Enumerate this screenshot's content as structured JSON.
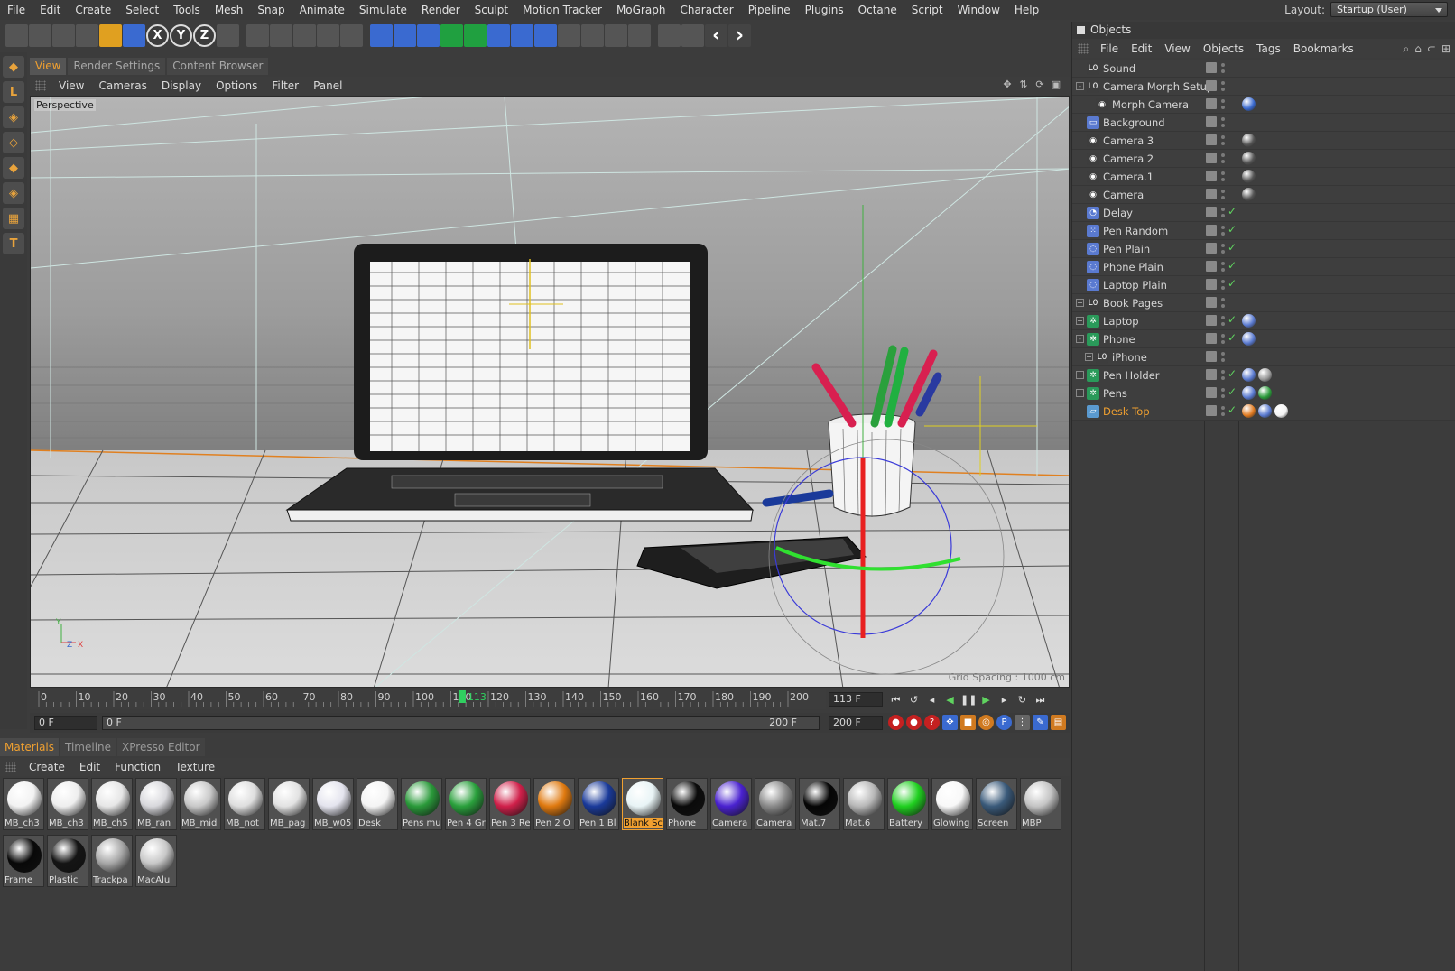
{
  "menubar": {
    "items": [
      "File",
      "Edit",
      "Create",
      "Select",
      "Tools",
      "Mesh",
      "Snap",
      "Animate",
      "Simulate",
      "Render",
      "Sculpt",
      "Motion Tracker",
      "MoGraph",
      "Character",
      "Pipeline",
      "Plugins",
      "Octane",
      "Script",
      "Window",
      "Help"
    ],
    "layout_label": "Layout:",
    "layout_value": "Startup (User)"
  },
  "toolbar": {
    "icons": [
      "select-arrow-icon",
      "live-select-icon",
      "rotate-select-icon",
      "move-icon",
      "scale-icon",
      "rotate-icon",
      "x-axis-icon",
      "y-axis-icon",
      "z-axis-icon",
      "coordinate-system-icon",
      "render-view-icon",
      "render-picture-icon",
      "edit-render-settings-icon",
      "render-queue-icon",
      "interactive-render-icon",
      "null-object-icon",
      "cube-icon",
      "sphere-icon",
      "nurbs-icon",
      "array-icon",
      "deformer-icon",
      "floor-icon",
      "scene-icon",
      "camera-icon",
      "light-icon",
      "help-icon",
      "calculator-icon",
      "octane-live-viewer-icon",
      "octane-settings-icon",
      "undo-arrow-icon",
      "redo-arrow-icon"
    ],
    "axis_labels": [
      "X",
      "Y",
      "Z"
    ]
  },
  "left_tools": [
    "model-mode-icon",
    "edge-mode-icon",
    "texture-mode-icon",
    "points-mode-icon",
    "polygon-mode-icon",
    "object-axis-icon",
    "checker-icon",
    "text-tool-icon"
  ],
  "viewport": {
    "tabs": [
      "View",
      "Render Settings",
      "Content Browser"
    ],
    "active_tab": "View",
    "menu": [
      "View",
      "Cameras",
      "Display",
      "Options",
      "Filter",
      "Panel"
    ],
    "camera_label": "Perspective",
    "grid_spacing": "Grid Spacing : 1000 cm",
    "axis_labels": [
      "Y",
      "Z",
      "X"
    ]
  },
  "timeline": {
    "ticks": [
      "0",
      "10",
      "20",
      "30",
      "40",
      "50",
      "60",
      "70",
      "80",
      "90",
      "100",
      "110",
      "120",
      "130",
      "140",
      "150",
      "160",
      "170",
      "180",
      "190",
      "200"
    ],
    "current_frame_marker": "113",
    "current_frame": "113 F",
    "start_field": "0 F",
    "range_start": "0 F",
    "range_end": "200 F",
    "end_field": "200 F"
  },
  "materials": {
    "tabs": [
      "Materials",
      "Timeline",
      "XPresso Editor"
    ],
    "active_tab": "Materials",
    "menu": [
      "Create",
      "Edit",
      "Function",
      "Texture"
    ],
    "items": [
      {
        "name": "MB_ch3",
        "color": "#f2f2f2"
      },
      {
        "name": "MB_ch3",
        "color": "#eeeeee"
      },
      {
        "name": "MB_ch5",
        "color": "#e6e6e6"
      },
      {
        "name": "MB_ran",
        "color": "#d8d8dc"
      },
      {
        "name": "MB_mid",
        "color": "#c8c8c8"
      },
      {
        "name": "MB_not",
        "color": "#dedede"
      },
      {
        "name": "MB_pag",
        "color": "#e2e2e2"
      },
      {
        "name": "MB_w05",
        "color": "#e4e4ee"
      },
      {
        "name": "Desk",
        "color": "#f4f4f4"
      },
      {
        "name": "Pens mu",
        "color": "#2a9a3a"
      },
      {
        "name": "Pen 4 Gr",
        "color": "#2aa03c"
      },
      {
        "name": "Pen 3 Re",
        "color": "#d0204a"
      },
      {
        "name": "Pen 2 O",
        "color": "#e07a10"
      },
      {
        "name": "Pen 1 Bl",
        "color": "#1a3a9a"
      },
      {
        "name": "Blank Sc",
        "color": "#e8f4f6"
      },
      {
        "name": "Phone",
        "color": "#0a0a0a"
      },
      {
        "name": "Camera",
        "color": "#4a22d0"
      },
      {
        "name": "Camera",
        "color": "#8a8a8a"
      },
      {
        "name": "Mat.7",
        "color": "#050505"
      },
      {
        "name": "Mat.6",
        "color": "#b8b8b8"
      },
      {
        "name": "Battery",
        "color": "#20d020"
      },
      {
        "name": "Glowing",
        "color": "#f8f8f8"
      },
      {
        "name": "Screen",
        "color": "#3a5a7a"
      },
      {
        "name": "MBP",
        "color": "#c4c4c4"
      },
      {
        "name": "Frame",
        "color": "#080808"
      },
      {
        "name": "Plastic",
        "color": "#141414"
      },
      {
        "name": "Trackpa",
        "color": "#a8a8a8"
      },
      {
        "name": "MacAlu",
        "color": "#c8c8c8"
      }
    ],
    "selected": "Blank Sc"
  },
  "objects": {
    "title": "Objects",
    "menu": [
      "File",
      "Edit",
      "View",
      "Objects",
      "Tags",
      "Bookmarks"
    ],
    "rows": [
      {
        "name": "Sound",
        "icon": "null-object-icon",
        "indent": 0,
        "expand": "",
        "check": false
      },
      {
        "name": "Camera Morph Setup",
        "icon": "null-object-icon",
        "indent": 0,
        "expand": "-",
        "check": false
      },
      {
        "name": "Morph Camera",
        "icon": "camera-icon",
        "indent": 1,
        "expand": "",
        "check": false
      },
      {
        "name": "Background",
        "icon": "background-icon",
        "indent": 0,
        "expand": "",
        "check": false
      },
      {
        "name": "Camera 3",
        "icon": "camera-icon",
        "indent": 0,
        "expand": "",
        "check": false
      },
      {
        "name": "Camera 2",
        "icon": "camera-icon",
        "indent": 0,
        "expand": "",
        "check": false
      },
      {
        "name": "Camera.1",
        "icon": "camera-icon",
        "indent": 0,
        "expand": "",
        "check": false
      },
      {
        "name": "Camera",
        "icon": "camera-icon",
        "indent": 0,
        "expand": "",
        "check": false
      },
      {
        "name": "Delay",
        "icon": "delay-effector-icon",
        "indent": 0,
        "expand": "",
        "check": true
      },
      {
        "name": "Pen Random",
        "icon": "random-effector-icon",
        "indent": 0,
        "expand": "",
        "check": true
      },
      {
        "name": "Pen Plain",
        "icon": "plain-effector-icon",
        "indent": 0,
        "expand": "",
        "check": true
      },
      {
        "name": "Phone Plain",
        "icon": "plain-effector-icon",
        "indent": 0,
        "expand": "",
        "check": true
      },
      {
        "name": "Laptop Plain",
        "icon": "plain-effector-icon",
        "indent": 0,
        "expand": "",
        "check": true
      },
      {
        "name": "Book Pages",
        "icon": "null-object-icon",
        "indent": 0,
        "expand": "+",
        "check": false
      },
      {
        "name": "Laptop",
        "icon": "fracture-icon",
        "indent": 0,
        "expand": "+",
        "check": true
      },
      {
        "name": "Phone",
        "icon": "fracture-icon",
        "indent": 0,
        "expand": "-",
        "check": true
      },
      {
        "name": "iPhone",
        "icon": "null-object-icon",
        "indent": 1,
        "expand": "+",
        "check": false
      },
      {
        "name": "Pen Holder",
        "icon": "fracture-icon",
        "indent": 0,
        "expand": "+",
        "check": true
      },
      {
        "name": "Pens",
        "icon": "fracture-icon",
        "indent": 0,
        "expand": "+",
        "check": true
      },
      {
        "name": "Desk Top",
        "icon": "plane-icon",
        "indent": 0,
        "expand": "",
        "check": true,
        "selected": true
      }
    ]
  },
  "colors": {
    "accent": "#f0a030",
    "bg": "#3c3c3c",
    "viewport_bg": "#9a9a9a",
    "check": "#5fd35f"
  }
}
